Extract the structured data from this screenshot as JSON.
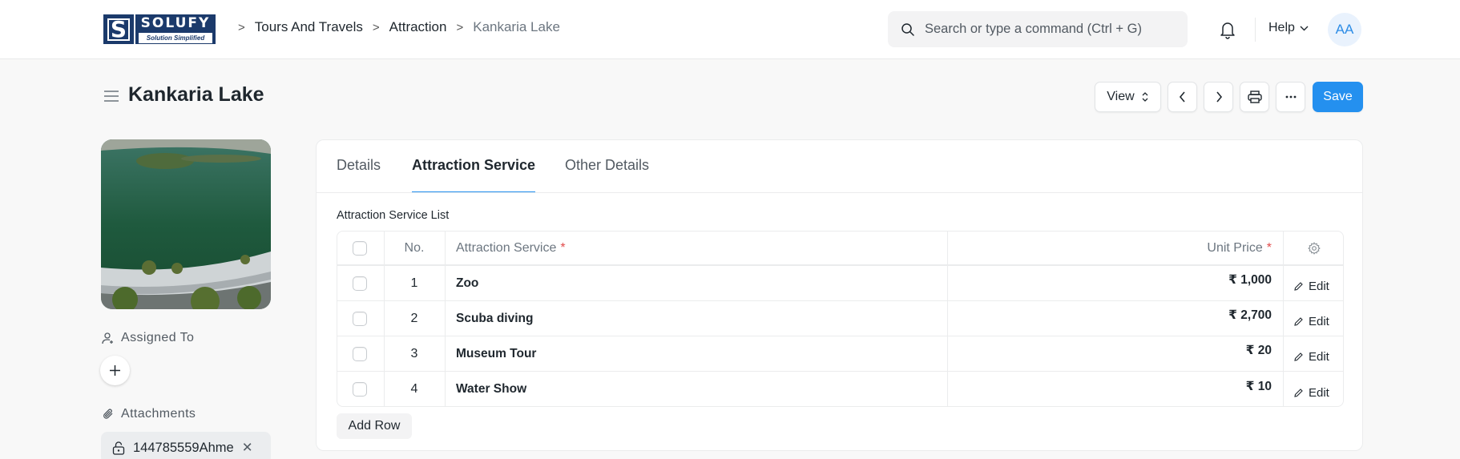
{
  "navbar": {
    "logo": {
      "main": "SOLUFY",
      "sub": "Solution Simplified",
      "mark": "S"
    },
    "breadcrumbs": [
      {
        "label": "Tours And Travels"
      },
      {
        "label": "Attraction"
      },
      {
        "label": "Kankaria Lake"
      }
    ],
    "search_placeholder": "Search or type a command (Ctrl + G)",
    "help_label": "Help",
    "avatar_initials": "AA"
  },
  "page": {
    "title": "Kankaria Lake",
    "toolbar": {
      "view_label": "View",
      "save_label": "Save"
    }
  },
  "sidebar": {
    "assigned_to_label": "Assigned To",
    "attachments_label": "Attachments",
    "attachments": [
      {
        "name": "144785559Ahme"
      }
    ]
  },
  "tabs": [
    {
      "label": "Details",
      "active": false
    },
    {
      "label": "Attraction Service",
      "active": true
    },
    {
      "label": "Other Details",
      "active": false
    }
  ],
  "table": {
    "section_label": "Attraction Service List",
    "columns": {
      "no": "No.",
      "service": "Attraction Service",
      "price": "Unit Price",
      "required_mark": "*"
    },
    "rows": [
      {
        "no": "1",
        "service": "Zoo",
        "price": "₹ 1,000",
        "action": "Edit"
      },
      {
        "no": "2",
        "service": "Scuba diving",
        "price": "₹ 2,700",
        "action": "Edit"
      },
      {
        "no": "3",
        "service": "Museum Tour",
        "price": "₹ 20",
        "action": "Edit"
      },
      {
        "no": "4",
        "service": "Water Show",
        "price": "₹ 10",
        "action": "Edit"
      }
    ],
    "add_row_label": "Add Row"
  },
  "colors": {
    "primary": "#2490ef",
    "required": "#e24c4c",
    "logo_navy": "#1b3a6b"
  }
}
